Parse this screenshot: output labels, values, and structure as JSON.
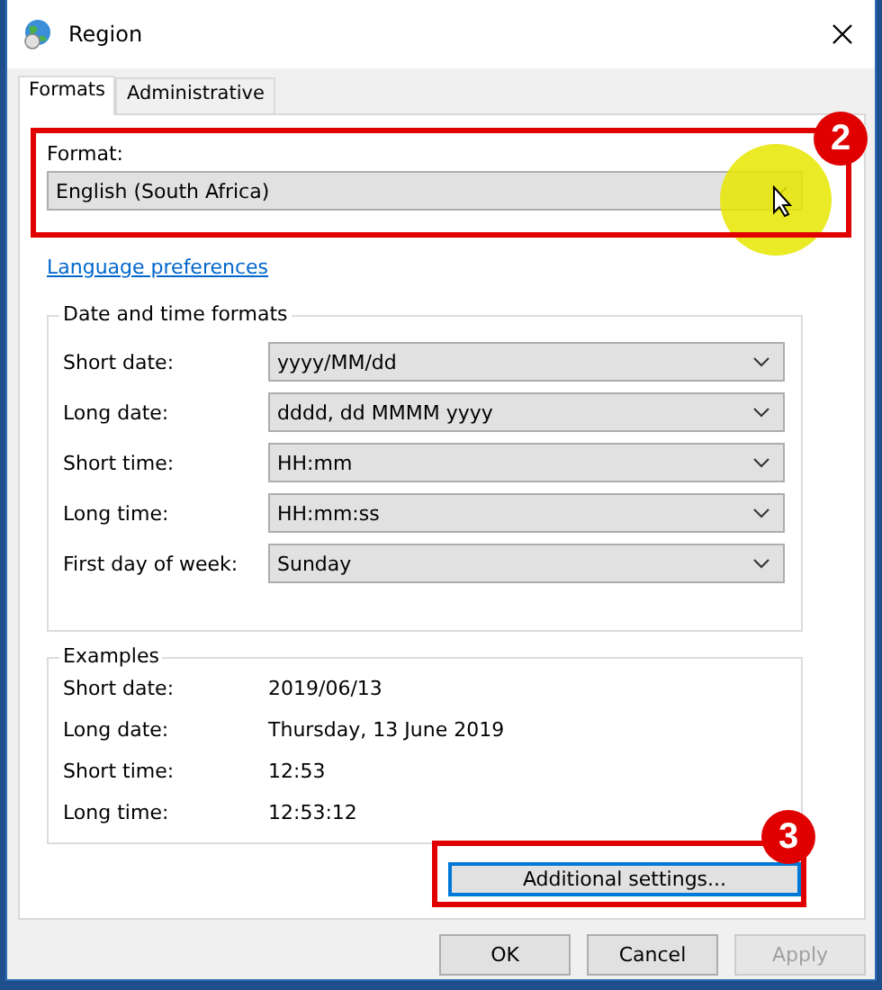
{
  "window": {
    "title": "Region"
  },
  "tabs": [
    {
      "label": "Formats",
      "selected": true
    },
    {
      "label": "Administrative",
      "selected": false
    }
  ],
  "format": {
    "label": "Format:",
    "value": "English (South Africa)"
  },
  "link": "Language preferences",
  "date_time_formats": {
    "title": "Date and time formats",
    "rows": [
      {
        "label": "Short date:",
        "value": "yyyy/MM/dd"
      },
      {
        "label": "Long date:",
        "value": "dddd, dd MMMM yyyy"
      },
      {
        "label": "Short time:",
        "value": "HH:mm"
      },
      {
        "label": "Long time:",
        "value": "HH:mm:ss"
      },
      {
        "label": "First day of week:",
        "value": "Sunday"
      }
    ]
  },
  "examples": {
    "title": "Examples",
    "rows": [
      {
        "label": "Short date:",
        "value": "2019/06/13"
      },
      {
        "label": "Long date:",
        "value": "Thursday, 13 June 2019"
      },
      {
        "label": "Short time:",
        "value": "12:53"
      },
      {
        "label": "Long time:",
        "value": "12:53:12"
      }
    ]
  },
  "additional_settings": "Additional settings...",
  "buttons": [
    {
      "label": "OK",
      "disabled": false
    },
    {
      "label": "Cancel",
      "disabled": false
    },
    {
      "label": "Apply",
      "disabled": true
    }
  ],
  "callouts": [
    "2",
    "3"
  ]
}
